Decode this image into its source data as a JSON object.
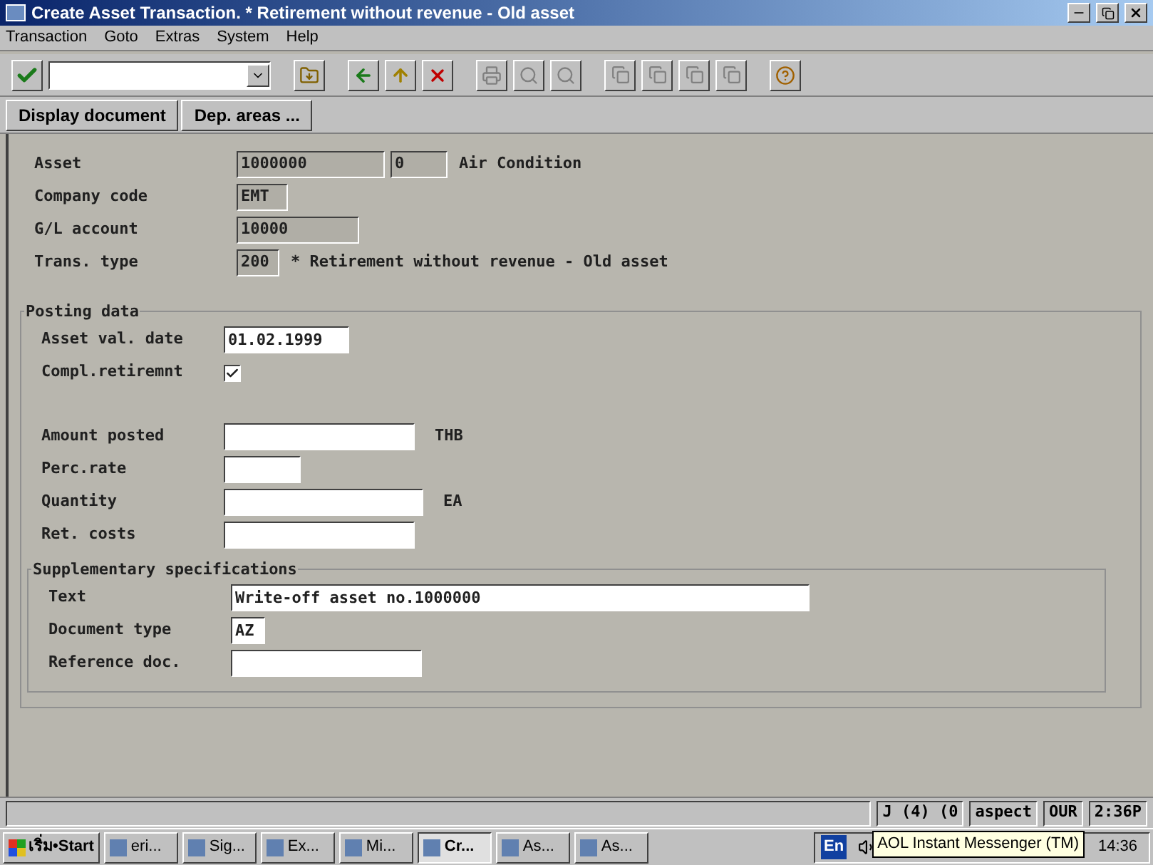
{
  "window": {
    "title": "Create Asset Transaction. * Retirement without revenue - Old asset"
  },
  "menu": [
    "Transaction",
    "Goto",
    "Extras",
    "System",
    "Help"
  ],
  "app_buttons": [
    "Display document",
    "Dep. areas ..."
  ],
  "header_fields": [
    {
      "label": "Asset",
      "kind": "display",
      "values": [
        "1000000",
        "0"
      ],
      "description": "Air Condition"
    },
    {
      "label": "Company code",
      "kind": "display",
      "values": [
        "EMT"
      ]
    },
    {
      "label": "G/L account",
      "kind": "display",
      "values": [
        "10000"
      ]
    },
    {
      "label": "Trans. type",
      "kind": "display",
      "values": [
        "200"
      ],
      "description": "* Retirement without revenue - Old asset"
    }
  ],
  "posting_data": {
    "title": "Posting data",
    "fields": [
      {
        "kind": "input",
        "label": "Asset val. date",
        "value": "01.02.1999"
      },
      {
        "kind": "checkbox",
        "label": "Compl.retiremnt",
        "checked": true
      },
      {
        "kind": "gap"
      },
      {
        "kind": "input",
        "label": "Amount posted",
        "unit": "THB"
      },
      {
        "kind": "input",
        "label": "Perc.rate"
      },
      {
        "kind": "input",
        "label": "Quantity",
        "unit": "EA"
      },
      {
        "kind": "input",
        "label": "Ret. costs"
      }
    ]
  },
  "supplementary": {
    "title": "Supplementary specifications",
    "fields": [
      {
        "label": "Text",
        "value": "Write-off asset no.1000000"
      },
      {
        "label": "Document type",
        "value": "AZ"
      },
      {
        "label": "Reference doc."
      }
    ]
  },
  "status_bar": [
    "J (4) (0",
    "aspect",
    "OUR",
    "2:36P"
  ],
  "taskbar": {
    "start": "เริ่ม•Start",
    "items": [
      {
        "label": "eri...",
        "selected": false
      },
      {
        "label": "Sig...",
        "selected": false
      },
      {
        "label": "Ex...",
        "selected": false
      },
      {
        "label": "Mi...",
        "selected": false
      },
      {
        "label": "Cr...",
        "selected": true
      },
      {
        "label": "As...",
        "selected": false
      },
      {
        "label": "As...",
        "selected": false
      }
    ],
    "language": "En",
    "clock": "14:36",
    "tooltip": "AOL Instant Messenger (TM)"
  }
}
